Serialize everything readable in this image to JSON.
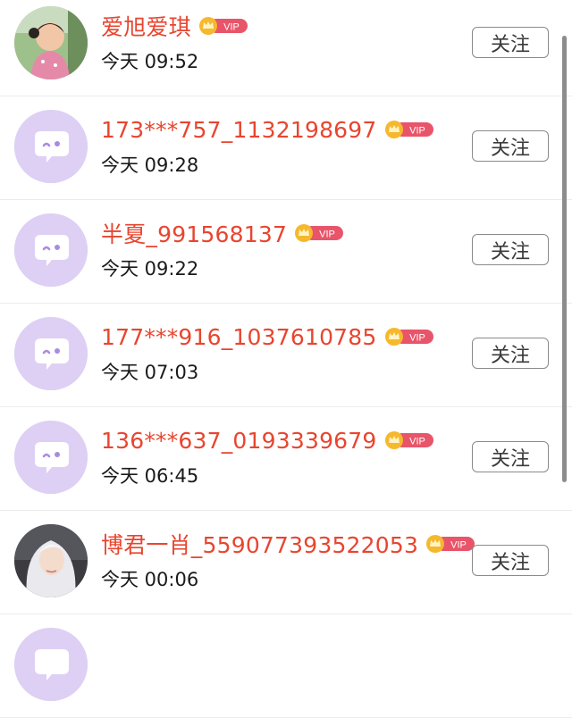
{
  "follow_label": "关注",
  "vip_label": "VIP",
  "colors": {
    "name": "#e8452f",
    "vip_badge": "#e8556a",
    "crown": "#f6b82d",
    "avatar_bg": "#ded0f4",
    "avatar_bubble": "#a98be2"
  },
  "users": [
    {
      "name": "爱旭爱琪",
      "time": "今天 09:52",
      "avatar": "photo-child"
    },
    {
      "name": "173***757_1132198697",
      "time": "今天 09:28",
      "avatar": "default-chat-bubble"
    },
    {
      "name": "半夏_991568137",
      "time": "今天 09:22",
      "avatar": "default-chat-bubble"
    },
    {
      "name": "177***916_1037610785",
      "time": "今天 07:03",
      "avatar": "default-chat-bubble"
    },
    {
      "name": "136***637_0193339679",
      "time": "今天 06:45",
      "avatar": "default-chat-bubble"
    },
    {
      "name": "博君一肖_559077393522053",
      "time": "今天 00:06",
      "avatar": "photo-white-hair"
    },
    {
      "name": "",
      "time": "",
      "avatar": "default-chat-bubble"
    }
  ]
}
